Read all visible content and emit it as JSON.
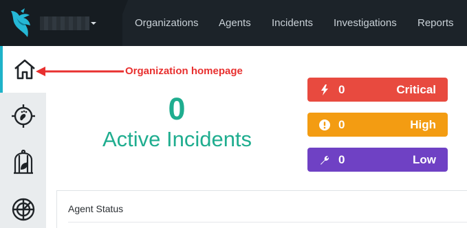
{
  "nav": {
    "items": [
      "Organizations",
      "Agents",
      "Incidents",
      "Investigations",
      "Reports"
    ]
  },
  "sidebar": {
    "items": [
      {
        "icon": "home-icon",
        "active": true
      },
      {
        "icon": "footprint-target-icon",
        "active": false
      },
      {
        "icon": "canary-cage-icon",
        "active": false
      },
      {
        "icon": "radar-icon",
        "active": false
      }
    ]
  },
  "annotation": {
    "text": "Organization homepage",
    "color": "#e8302f"
  },
  "incidents": {
    "count": "0",
    "label": "Active Incidents",
    "color": "#1fad8f"
  },
  "severity": {
    "critical": {
      "count": "0",
      "label": "Critical",
      "color": "#e84a3f",
      "icon": "bolt-icon"
    },
    "high": {
      "count": "0",
      "label": "High",
      "color": "#f39c12",
      "icon": "exclamation-circle-icon"
    },
    "low": {
      "count": "0",
      "label": "Low",
      "color": "#6f41c4",
      "icon": "wrench-icon"
    }
  },
  "agent_status": {
    "title": "Agent Status"
  },
  "colors": {
    "accent": "#1fb3c9",
    "topbar": "#1c2329"
  }
}
